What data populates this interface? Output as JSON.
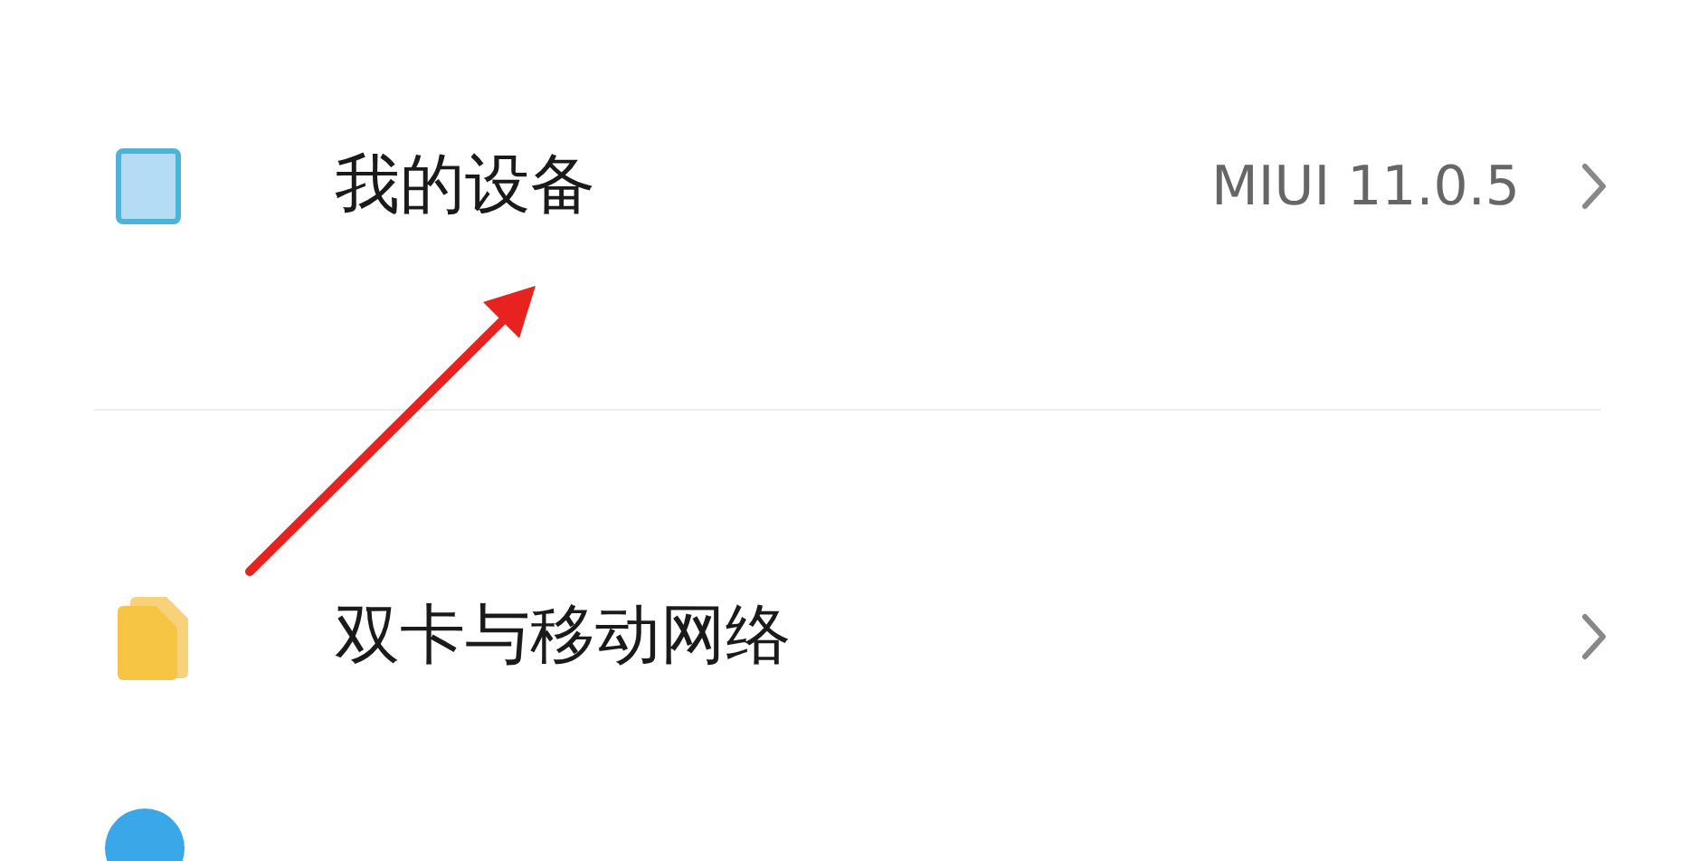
{
  "settings_items": [
    {
      "kind": "device",
      "label": "我的设备",
      "value": "MIUI 11.0.5"
    },
    {
      "kind": "sim",
      "label": "双卡与移动网络"
    },
    {
      "kind": "circle"
    }
  ]
}
